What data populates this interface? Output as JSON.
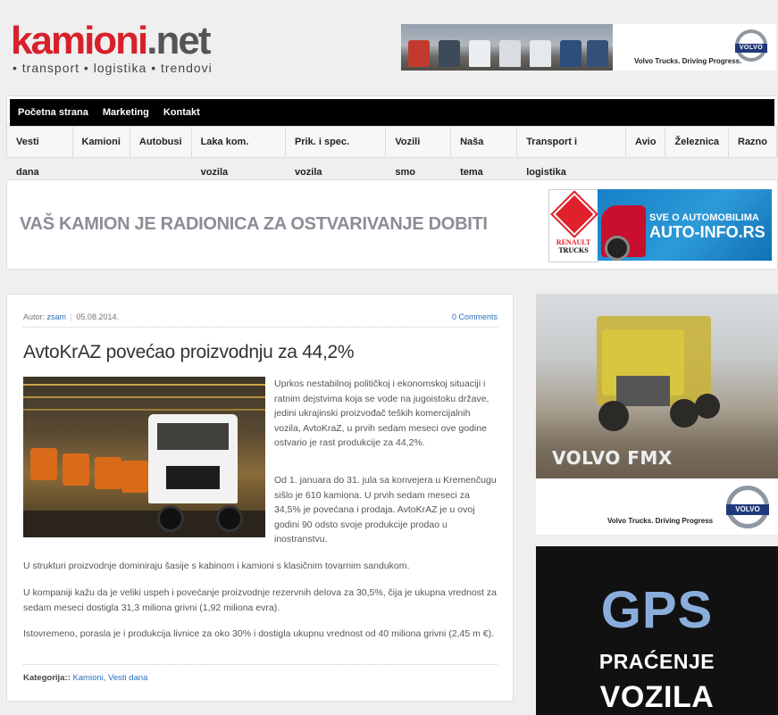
{
  "site": {
    "logo_main": "kamioni",
    "logo_dot_net": ".net",
    "logo_tagline": "• transport • logistika • trendovi"
  },
  "top_banner": {
    "slogan": "Volvo Trucks. Driving Progress.",
    "badge": "VOLVO"
  },
  "nav": {
    "top": [
      "Početna strana",
      "Marketing",
      "Kontakt"
    ],
    "categories": [
      "Vesti dana",
      "Kamioni",
      "Autobusi",
      "Laka kom. vozila",
      "Prik. i spec. vozila",
      "Vozili smo",
      "Naša tema",
      "Transport i logistika",
      "Avio",
      "Železnica",
      "Razno"
    ]
  },
  "banner2": {
    "headline": "VAŠ KAMION JE RADIONICA ZA OSTVARIVANJE DOBITI",
    "renault_line1": "RENAULT",
    "renault_line2": "TRUCKS",
    "autoinfo_line1": "SVE O AUTOMOBILIMA",
    "autoinfo_line2": "AUTO-INFO.RS"
  },
  "article": {
    "author_label": "Autor:",
    "author": "zsam",
    "date": "05.08.2014.",
    "comments": "0 Comments",
    "title": "AvtoKrAZ povećao proizvodnju za 44,2%",
    "paragraphs": [
      "Uprkos nestabilnoj političkoj i ekonomskoj situaciji i ratnim dejstvima koja se vode na jugoistoku države, jedini ukrajinski proizvođač teških komercijalnih vozila, AvtoKraZ, u prvih sedam meseci ove godine ostvario je rast produkcije za 44,2%.",
      "Od 1. januara do 31. jula sa konvejera u Kremenčugu sišlo je 610 kamiona. U prvih sedam meseci za 34,5% je povećana i prodaja. AvtoKrAZ je u ovoj godini 90 odsto svoje produkcije prodao u inostranstvu.",
      "U strukturi proizvodnje dominiraju šasije s kabinom i kamioni s klasičnim tovarnim sandukom.",
      "U kompaniji kažu da je veliki uspeh i povećanje proizvodnje rezervnih delova za 30,5%, čija je ukupna vrednost za sedam meseci dostigla 31,3 miliona grivni (1,92 miliona  evra).",
      "Istovremeno, porasla je i produkcija livnice za oko 30% i dostigla ukupnu vrednost od 40 miliona grivni  (2,45 m €)."
    ],
    "categories_label": "Kategorija::",
    "categories": [
      "Kamioni",
      "Vesti dana"
    ],
    "categories_sep": ", "
  },
  "sidebar": {
    "volvo_model": "VOLVO FMX",
    "volvo_slogan": "Volvo Trucks. Driving Progress",
    "volvo_badge": "VOLVO",
    "gps_line1": "GPS",
    "gps_line2": "PRAĆENJE",
    "gps_line3": "VOZILA"
  }
}
